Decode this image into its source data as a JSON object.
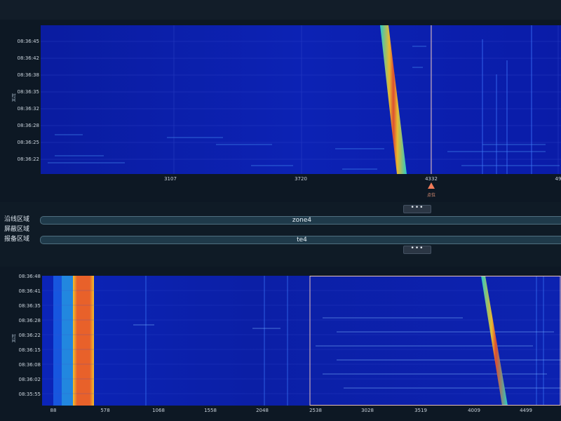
{
  "top_panel": {
    "y_axis_title": "时间",
    "y_ticks": [
      "08:36:45",
      "08:36:42",
      "08:36:38",
      "08:36:35",
      "08:36:32",
      "08:36:28",
      "08:36:25",
      "08:36:22"
    ],
    "x_ticks": [
      "3107",
      "3720",
      "4332",
      "49"
    ],
    "marker_label": "点位"
  },
  "more_button_label": "•••",
  "zones": [
    {
      "label": "沿线区域",
      "value": "zone4"
    },
    {
      "label": "屏蔽区域",
      "value": ""
    },
    {
      "label": "报备区域",
      "value": "te4"
    }
  ],
  "bottom_panel": {
    "y_axis_title": "时间",
    "y_ticks": [
      "08:36:48",
      "08:36:41",
      "08:36:35",
      "08:36:28",
      "08:36:22",
      "08:36:15",
      "08:36:08",
      "08:36:02",
      "08:35:55"
    ],
    "x_ticks": [
      "88",
      "578",
      "1068",
      "1558",
      "2048",
      "2538",
      "3028",
      "3519",
      "4009",
      "4499"
    ]
  },
  "colors": {
    "waterfall_bg": "#0b1fa6",
    "hot": "#e8512a",
    "warm": "#f2c02a",
    "cool": "#29d3c9",
    "marker": "#ef7b5a"
  }
}
